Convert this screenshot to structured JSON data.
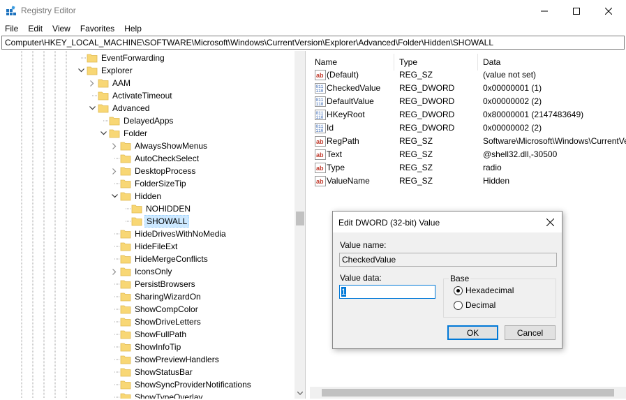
{
  "window": {
    "title": "Registry Editor"
  },
  "menu": [
    "File",
    "Edit",
    "View",
    "Favorites",
    "Help"
  ],
  "address": "Computer\\HKEY_LOCAL_MACHINE\\SOFTWARE\\Microsoft\\Windows\\CurrentVersion\\Explorer\\Advanced\\Folder\\Hidden\\SHOWALL",
  "tree": [
    {
      "label": "EventForwarding",
      "level": 0,
      "expander": "none"
    },
    {
      "label": "Explorer",
      "level": 0,
      "expander": "expanded"
    },
    {
      "label": "AAM",
      "level": 1,
      "expander": "collapsed"
    },
    {
      "label": "ActivateTimeout",
      "level": 1,
      "expander": "none"
    },
    {
      "label": "Advanced",
      "level": 1,
      "expander": "expanded"
    },
    {
      "label": "DelayedApps",
      "level": 2,
      "expander": "none"
    },
    {
      "label": "Folder",
      "level": 2,
      "expander": "expanded"
    },
    {
      "label": "AlwaysShowMenus",
      "level": 3,
      "expander": "collapsed"
    },
    {
      "label": "AutoCheckSelect",
      "level": 3,
      "expander": "none"
    },
    {
      "label": "DesktopProcess",
      "level": 3,
      "expander": "collapsed"
    },
    {
      "label": "FolderSizeTip",
      "level": 3,
      "expander": "none"
    },
    {
      "label": "Hidden",
      "level": 3,
      "expander": "expanded"
    },
    {
      "label": "NOHIDDEN",
      "level": 4,
      "expander": "none"
    },
    {
      "label": "SHOWALL",
      "level": 4,
      "expander": "none",
      "selected": true
    },
    {
      "label": "HideDrivesWithNoMedia",
      "level": 3,
      "expander": "none"
    },
    {
      "label": "HideFileExt",
      "level": 3,
      "expander": "none"
    },
    {
      "label": "HideMergeConflicts",
      "level": 3,
      "expander": "none"
    },
    {
      "label": "IconsOnly",
      "level": 3,
      "expander": "collapsed"
    },
    {
      "label": "PersistBrowsers",
      "level": 3,
      "expander": "none"
    },
    {
      "label": "SharingWizardOn",
      "level": 3,
      "expander": "none"
    },
    {
      "label": "ShowCompColor",
      "level": 3,
      "expander": "none"
    },
    {
      "label": "ShowDriveLetters",
      "level": 3,
      "expander": "none"
    },
    {
      "label": "ShowFullPath",
      "level": 3,
      "expander": "none"
    },
    {
      "label": "ShowInfoTip",
      "level": 3,
      "expander": "none"
    },
    {
      "label": "ShowPreviewHandlers",
      "level": 3,
      "expander": "none"
    },
    {
      "label": "ShowStatusBar",
      "level": 3,
      "expander": "none"
    },
    {
      "label": "ShowSyncProviderNotifications",
      "level": 3,
      "expander": "none"
    },
    {
      "label": "ShowTypeOverlay",
      "level": 3,
      "expander": "none"
    }
  ],
  "list": {
    "columns": [
      "Name",
      "Type",
      "Data"
    ],
    "rows": [
      {
        "name": "(Default)",
        "type": "REG_SZ",
        "data": "(value not set)",
        "icon": "string-value-icon"
      },
      {
        "name": "CheckedValue",
        "type": "REG_DWORD",
        "data": "0x00000001 (1)",
        "icon": "binary-value-icon"
      },
      {
        "name": "DefaultValue",
        "type": "REG_DWORD",
        "data": "0x00000002 (2)",
        "icon": "binary-value-icon"
      },
      {
        "name": "HKeyRoot",
        "type": "REG_DWORD",
        "data": "0x80000001 (2147483649)",
        "icon": "binary-value-icon"
      },
      {
        "name": "Id",
        "type": "REG_DWORD",
        "data": "0x00000002 (2)",
        "icon": "binary-value-icon"
      },
      {
        "name": "RegPath",
        "type": "REG_SZ",
        "data": "Software\\Microsoft\\Windows\\CurrentVersion\\Explorer\\Advanced",
        "icon": "string-value-icon"
      },
      {
        "name": "Text",
        "type": "REG_SZ",
        "data": "@shell32.dll,-30500",
        "icon": "string-value-icon"
      },
      {
        "name": "Type",
        "type": "REG_SZ",
        "data": "radio",
        "icon": "string-value-icon"
      },
      {
        "name": "ValueName",
        "type": "REG_SZ",
        "data": "Hidden",
        "icon": "string-value-icon"
      }
    ]
  },
  "dialog": {
    "title": "Edit DWORD (32-bit) Value",
    "value_name_label": "Value name:",
    "value_name": "CheckedValue",
    "value_data_label": "Value data:",
    "value_data": "1",
    "base_label": "Base",
    "base_options": [
      {
        "label": "Hexadecimal",
        "checked": true
      },
      {
        "label": "Decimal",
        "checked": false
      }
    ],
    "ok_label": "OK",
    "cancel_label": "Cancel"
  },
  "colors": {
    "folder": "#f8d775",
    "folder_dark": "#e0b94f",
    "selection": "#cce8ff",
    "accent": "#0078d7",
    "icon_red": "#c0392b",
    "icon_blue": "#2a5db0"
  }
}
